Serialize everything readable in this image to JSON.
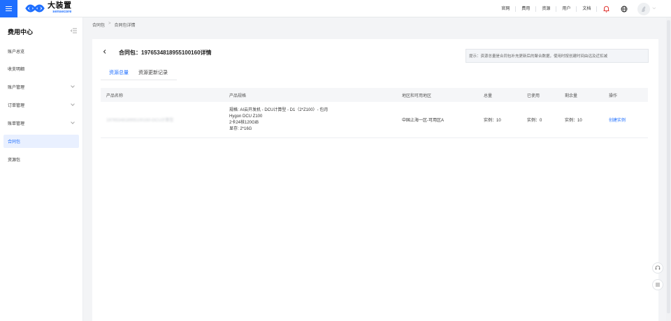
{
  "brand": {
    "title": "大装置",
    "sub": "sensecore"
  },
  "topnav": {
    "links": [
      "官网",
      "费用",
      "资源",
      "用户",
      "文档"
    ]
  },
  "sidebar": {
    "title": "费用中心",
    "items": [
      {
        "label": "账户总览"
      },
      {
        "label": "收支明细"
      },
      {
        "label": "账户管理"
      },
      {
        "label": "订单管理"
      },
      {
        "label": "账单管理"
      },
      {
        "label": "合同包"
      },
      {
        "label": "资源包"
      }
    ]
  },
  "breadcrumb": {
    "root": "合同包",
    "sep": ">",
    "current": "合同包详情"
  },
  "page": {
    "title": "合同包：1976534818955100160详情",
    "tip": "提示：资源总量是合同包补充更新后的聚合数据，使用时按创建时间由远及近扣减",
    "tabs": [
      {
        "label": "资源总量"
      },
      {
        "label": "资源更新记录"
      }
    ]
  },
  "table": {
    "headers": [
      "产品名称",
      "产品规格",
      "地区和可用地区",
      "总量",
      "已使用",
      "剩余量",
      "操作"
    ],
    "rows": [
      {
        "name": "1976534818955100160-DCU计算型",
        "spec": [
          "规格: AI云开发机 - DCU计算型 - D1（2*Z100）- 包月",
          "Hygon DCU Z100",
          "2卡24核120GiB",
          "显存: 2*16G"
        ],
        "region": "中国上海一区-可用区A",
        "total": "实例：10",
        "used": "实例：0",
        "remaining": "实例：10",
        "action": "创建实例"
      }
    ]
  },
  "colors": {
    "accent": "#1f6fff",
    "active_bg": "#e9f0ff"
  }
}
